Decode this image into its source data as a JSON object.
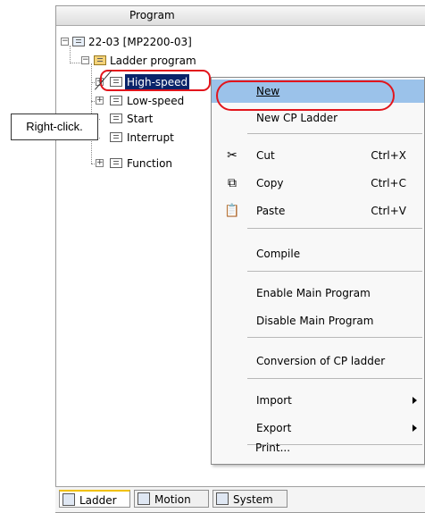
{
  "panel": {
    "title": "Program"
  },
  "tree": {
    "root": "22-03 [MP2200-03]",
    "ladder": "Ladder program",
    "items": [
      {
        "label": "High-speed"
      },
      {
        "label": "Low-speed"
      },
      {
        "label": "Start"
      },
      {
        "label": "Interrupt"
      },
      {
        "label": "Function"
      }
    ]
  },
  "menu": {
    "new": "New",
    "new_cp": "New CP Ladder",
    "cut": "Cut",
    "cut_sc": "Ctrl+X",
    "copy": "Copy",
    "copy_sc": "Ctrl+C",
    "paste": "Paste",
    "paste_sc": "Ctrl+V",
    "compile": "Compile",
    "enable": "Enable Main Program",
    "disable": "Disable Main Program",
    "conversion": "Conversion of CP ladder",
    "import": "Import",
    "export": "Export",
    "print": "Print..."
  },
  "callout": {
    "text": "Right-click."
  },
  "tabs": [
    {
      "label": "Ladder"
    },
    {
      "label": "Motion"
    },
    {
      "label": "System"
    }
  ],
  "colors": {
    "highlight": "#9bc2ea",
    "selection": "#0a246a",
    "annotation": "#e2151c"
  },
  "icons": [
    "scissors-icon",
    "copy-icon",
    "paste-icon",
    "submenu-arrow-icon",
    "folder-icon",
    "program-icon"
  ]
}
